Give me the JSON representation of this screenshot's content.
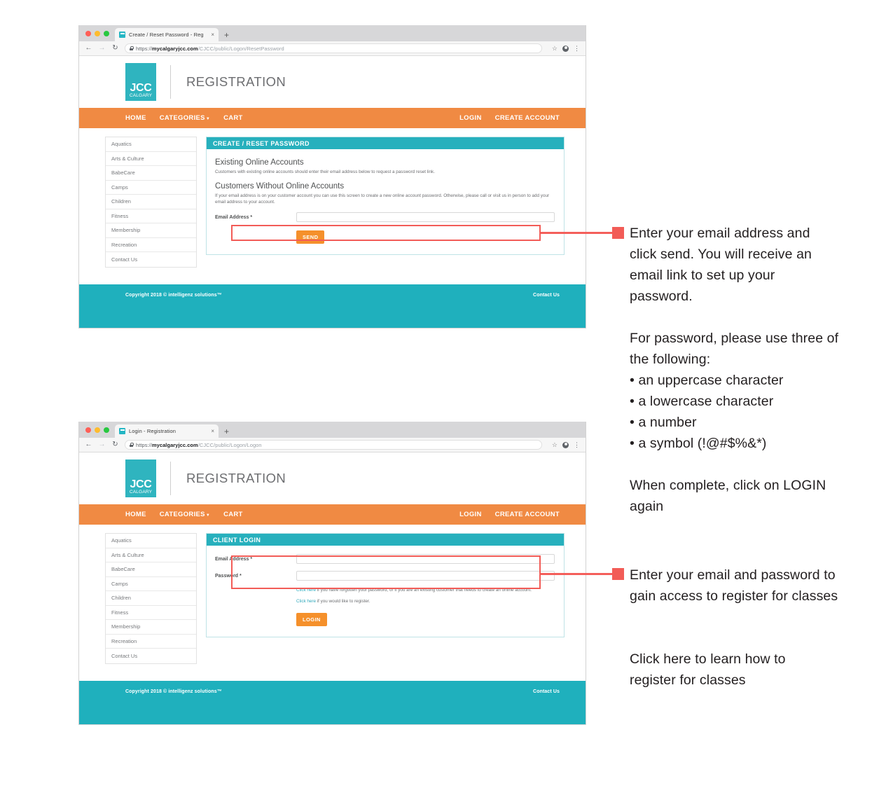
{
  "window_top": {
    "tab": {
      "title": "Create / Reset Password - Reg",
      "close": "×",
      "new_tab": "+"
    },
    "toolbar": {
      "back": "←",
      "forward": "→",
      "reload": "↻",
      "url_scheme": "https://",
      "url_host": "mycalgaryjcc.com",
      "url_path": "/CJCC/public/Logon/ResetPassword",
      "star": "☆",
      "kebab": "⋮"
    },
    "site": {
      "logo": {
        "name": "JCC",
        "sub": "CALGARY"
      },
      "title": "REGISTRATION",
      "nav_left": [
        {
          "label": "HOME",
          "caret": false
        },
        {
          "label": "CATEGORIES",
          "caret": true
        },
        {
          "label": "CART",
          "caret": false
        }
      ],
      "nav_right": [
        {
          "label": "LOGIN"
        },
        {
          "label": "CREATE ACCOUNT"
        }
      ],
      "sidebar": [
        "Aquatics",
        "Arts & Culture",
        "BabeCare",
        "Camps",
        "Children",
        "Fitness",
        "Membership",
        "Recreation",
        "Contact Us"
      ],
      "panel": {
        "header": "CREATE / RESET PASSWORD",
        "section1_title": "Existing Online Accounts",
        "section1_text": "Customers with existing online accounts should enter their email address below to request a password reset link.",
        "section2_title": "Customers Without Online Accounts",
        "section2_text": "If your email address is on your customer account you can use this screen to create a new online account password. Otherwise, please call or visit us in person to add your email address to your account.",
        "email_label": "Email Address *",
        "email_value": "",
        "email_placeholder": "",
        "send_button": "SEND"
      },
      "footer": {
        "copyright": "Copyright 2018 © intelligenz solutions™",
        "contact": "Contact Us"
      }
    }
  },
  "window_bottom": {
    "tab": {
      "title": "Login - Registration",
      "close": "×",
      "new_tab": "+"
    },
    "toolbar": {
      "back": "←",
      "forward": "→",
      "reload": "↻",
      "url_scheme": "https://",
      "url_host": "mycalgaryjcc.com",
      "url_path": "/CJCC/public/Logon/Logon",
      "star": "☆",
      "kebab": "⋮"
    },
    "site": {
      "logo": {
        "name": "JCC",
        "sub": "CALGARY"
      },
      "title": "REGISTRATION",
      "nav_left": [
        {
          "label": "HOME",
          "caret": false
        },
        {
          "label": "CATEGORIES",
          "caret": true
        },
        {
          "label": "CART",
          "caret": false
        }
      ],
      "nav_right": [
        {
          "label": "LOGIN"
        },
        {
          "label": "CREATE ACCOUNT"
        }
      ],
      "sidebar": [
        "Aquatics",
        "Arts & Culture",
        "BabeCare",
        "Camps",
        "Children",
        "Fitness",
        "Membership",
        "Recreation",
        "Contact Us"
      ],
      "panel": {
        "header": "CLIENT LOGIN",
        "email_label": "Email Address *",
        "email_value": "",
        "password_label": "Password *",
        "password_value": "",
        "note1_link": "Click here",
        "note1_text": " if you have forgotten your password, or if you are an existing customer that needs to create an online account.",
        "note2_link": "Click here",
        "note2_text": " if you would like to register.",
        "login_button": "LOGIN"
      },
      "footer": {
        "copyright": "Copyright 2018 © intelligenz solutions™",
        "contact": "Contact Us"
      }
    }
  },
  "annotations": {
    "note1": "Enter your email address and click send. You will receive an email link to set up your password.",
    "note2": "For password, please use three of the following:",
    "note2_bullets": [
      "• an uppercase character",
      "• a lowercase character",
      "• a number",
      "• a symbol (!@#$%&*)"
    ],
    "note3": "When complete, click on LOGIN again",
    "note4": "Enter your email and password to gain access to register for classes",
    "note5": "Click here to learn how to register for classes"
  },
  "colors": {
    "teal": "#1fb0bd",
    "teal_header": "#27b0bd",
    "orange_nav": "#f08a43",
    "orange_button": "#f5902b",
    "highlight_red": "#f25c57",
    "link_teal": "#31a8bb",
    "text_dark": "#231f20"
  }
}
